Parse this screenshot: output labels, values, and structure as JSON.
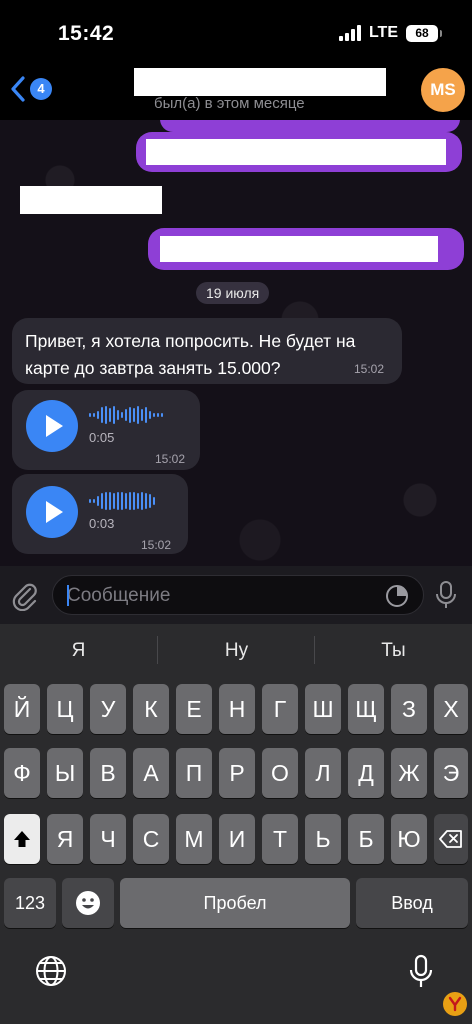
{
  "status_bar": {
    "time": "15:42",
    "network": "LTE",
    "battery": "68"
  },
  "header": {
    "back_count": "4",
    "subtitle": "был(а) в этом месяце",
    "avatar_initials": "MS"
  },
  "chat": {
    "date_separator": "19 июля",
    "text_message": {
      "text": "Привет, я хотела попросить. Не будет на карте до завтра занять 15.000?",
      "time": "15:02"
    },
    "voice_messages": [
      {
        "duration": "0:05",
        "time": "15:02"
      },
      {
        "duration": "0:03",
        "time": "15:02"
      }
    ]
  },
  "input": {
    "placeholder": "Сообщение"
  },
  "keyboard": {
    "suggestions": [
      "Я",
      "Ну",
      "Ты"
    ],
    "row1": [
      "Й",
      "Ц",
      "У",
      "К",
      "Е",
      "Н",
      "Г",
      "Ш",
      "Щ",
      "З",
      "Х"
    ],
    "row2": [
      "Ф",
      "Ы",
      "В",
      "А",
      "П",
      "Р",
      "О",
      "Л",
      "Д",
      "Ж",
      "Э"
    ],
    "row3": [
      "Я",
      "Ч",
      "С",
      "М",
      "И",
      "Т",
      "Ь",
      "Б",
      "Ю"
    ],
    "numbers_label": "123",
    "space_label": "Пробел",
    "return_label": "Ввод"
  },
  "colors": {
    "outgoing_bubble": "#8e3fd6",
    "accent_blue": "#3a86f5",
    "avatar": "#f5a34a"
  },
  "icons": [
    "chevron-left-icon",
    "paperclip-icon",
    "sticker-icon",
    "microphone-icon",
    "shift-icon",
    "backspace-icon",
    "emoji-icon",
    "globe-icon"
  ]
}
